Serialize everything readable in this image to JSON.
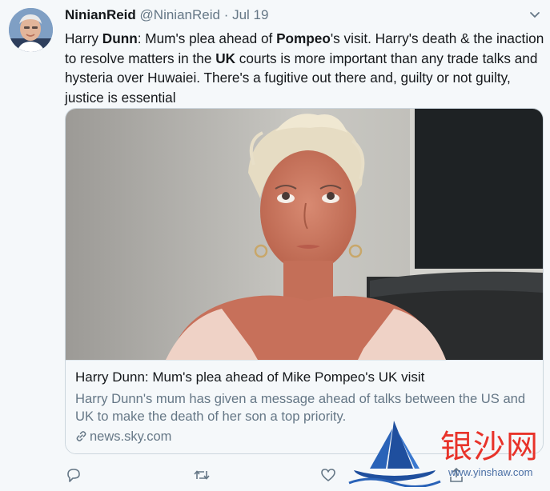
{
  "tweet": {
    "display_name": "NinianReid",
    "handle": "@NinianReid",
    "separator": "·",
    "date": "Jul 19",
    "text_segments": [
      {
        "text": "Harry ",
        "bold": false
      },
      {
        "text": "Dunn",
        "bold": true
      },
      {
        "text": ": Mum's plea ahead of ",
        "bold": false
      },
      {
        "text": "Pompeo",
        "bold": true
      },
      {
        "text": "'s visit. Harry's death & the inaction to resolve matters in the ",
        "bold": false
      },
      {
        "text": "UK",
        "bold": true
      },
      {
        "text": " courts is more important than any trade talks and hysteria over Huwaiei. There's a fugitive out there and, guilty or not guilty, justice is essential",
        "bold": false
      }
    ]
  },
  "card": {
    "title": "Harry Dunn: Mum's plea ahead of Mike Pompeo's UK visit",
    "description": "Harry Dunn's mum has given a message ahead of talks between the US and UK to make the death of her son a top priority.",
    "domain": "news.sky.com"
  },
  "actions": [
    {
      "name": "reply",
      "icon": "reply-icon"
    },
    {
      "name": "retweet",
      "icon": "retweet-icon"
    },
    {
      "name": "like",
      "icon": "heart-icon"
    },
    {
      "name": "share",
      "icon": "share-icon"
    }
  ],
  "watermark": {
    "chinese_text": "银沙网",
    "url": "www.yinshaw.com"
  },
  "colors": {
    "text_primary": "#14171a",
    "text_secondary": "#657786",
    "border": "#ccd6dd",
    "watermark_red": "#e8332a",
    "watermark_blue": "#1f4f9e"
  }
}
